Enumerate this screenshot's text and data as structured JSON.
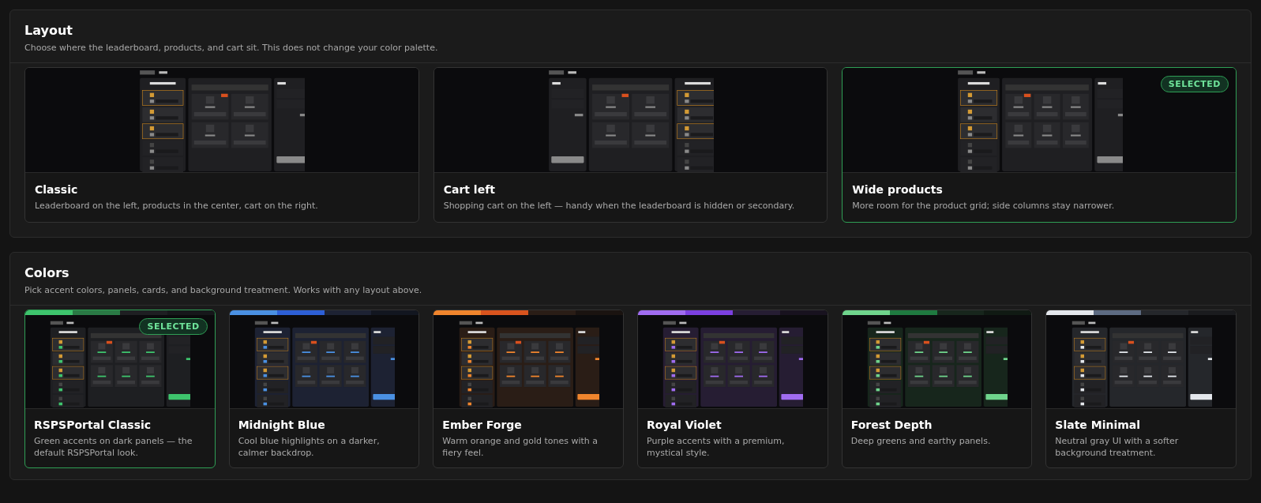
{
  "layout": {
    "title": "Layout",
    "description": "Choose where the leaderboard, products, and cart sit. This does not change your color palette.",
    "options": [
      {
        "kind": "classic",
        "name": "Classic",
        "description": "Leaderboard on the left, products in the center, cart on the right.",
        "selected": false
      },
      {
        "kind": "cart_left",
        "name": "Cart left",
        "description": "Shopping cart on the left — handy when the leaderboard is hidden or secondary.",
        "selected": false
      },
      {
        "kind": "wide",
        "name": "Wide products",
        "description": "More room for the product grid; side columns stay narrower.",
        "selected": true,
        "badge": "SELECTED"
      }
    ]
  },
  "colors": {
    "title": "Colors",
    "description": "Pick accent colors, panels, cards, and background treatment. Works with any layout above.",
    "options": [
      {
        "name": "RSPSPortal Classic",
        "description": "Green accents on dark panels — the default RSPSPortal look.",
        "selected": true,
        "badge": "SELECTED",
        "palette": [
          {
            "color": "#3ec46d"
          },
          {
            "color": "#2a7a45"
          },
          {
            "color": "#1e1f22"
          },
          {
            "color": "#16171a"
          }
        ]
      },
      {
        "name": "Midnight Blue",
        "description": "Cool blue highlights on a darker, calmer backdrop.",
        "selected": false,
        "palette": [
          {
            "color": "#4a90e2"
          },
          {
            "color": "#2d5fd6"
          },
          {
            "color": "#1d2233"
          },
          {
            "color": "#121620"
          }
        ]
      },
      {
        "name": "Ember Forge",
        "description": "Warm orange and gold tones with a fiery feel.",
        "selected": false,
        "palette": [
          {
            "color": "#f0852d"
          },
          {
            "color": "#d9541e"
          },
          {
            "color": "#2a1d16"
          },
          {
            "color": "#1a1310"
          }
        ]
      },
      {
        "name": "Royal Violet",
        "description": "Purple accents with a premium, mystical style.",
        "selected": false,
        "palette": [
          {
            "color": "#a06cf0"
          },
          {
            "color": "#7b3fe0"
          },
          {
            "color": "#261d33"
          },
          {
            "color": "#18121f"
          }
        ]
      },
      {
        "name": "Forest Depth",
        "description": "Deep greens and earthy panels.",
        "selected": false,
        "palette": [
          {
            "color": "#6fd48c"
          },
          {
            "color": "#1f7a40"
          },
          {
            "color": "#17261c"
          },
          {
            "color": "#101a13"
          }
        ]
      },
      {
        "name": "Slate Minimal",
        "description": "Neutral gray UI with a softer background treatment.",
        "selected": false,
        "palette": [
          {
            "color": "#e4e7ec"
          },
          {
            "color": "#5d6b82"
          },
          {
            "color": "#25272b"
          },
          {
            "color": "#1a1b1e"
          }
        ]
      }
    ]
  }
}
